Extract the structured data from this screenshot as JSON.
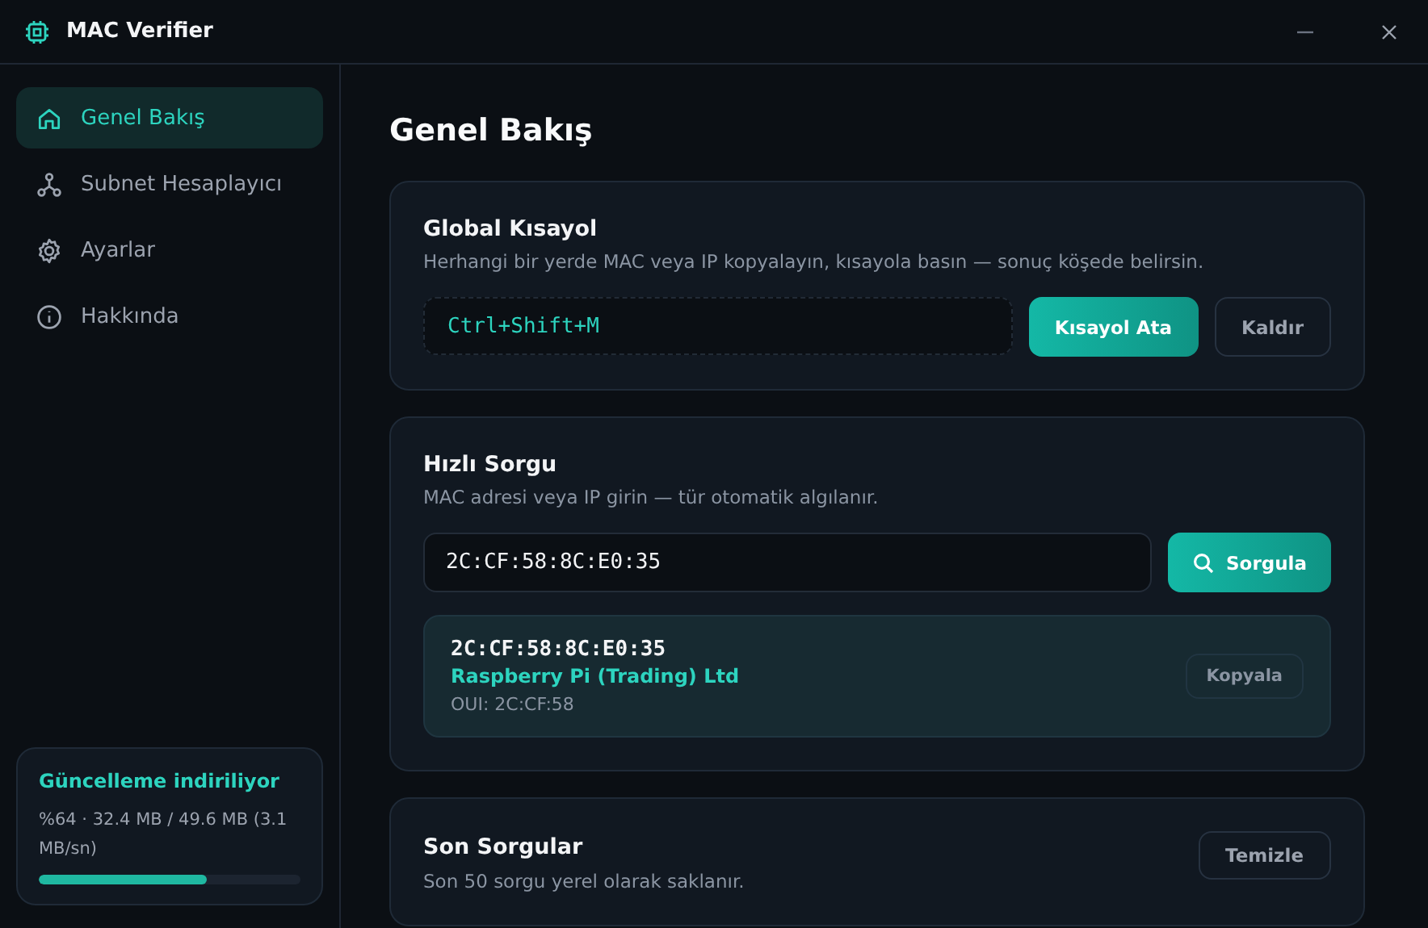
{
  "window": {
    "title": "MAC Verifier"
  },
  "sidebar": {
    "items": [
      {
        "label": "Genel Bakış",
        "selected": true
      },
      {
        "label": "Subnet Hesaplayıcı",
        "selected": false
      },
      {
        "label": "Ayarlar",
        "selected": false
      },
      {
        "label": "Hakkında",
        "selected": false
      }
    ],
    "update": {
      "title": "Güncelleme indiriliyor",
      "detail": "%64 · 32.4 MB / 49.6 MB (3.1 MB/sn)",
      "level": 0.64
    }
  },
  "page": {
    "title": "Genel Bakış"
  },
  "shortcut_card": {
    "title": "Global Kısayol",
    "description": "Herhangi bir yerde MAC veya IP kopyalayın, kısayola basın — sonuç köşede belirsin.",
    "shortcut": "Ctrl+Shift+M",
    "buttons": [
      "Kısayol Ata",
      "Kaldır"
    ]
  },
  "query_card": {
    "title": "Hızlı Sorgu",
    "description": "MAC adresi veya IP girin — tür otomatik algılanır.",
    "value": "2C:CF:58:8C:E0:35",
    "button": "Sorgula",
    "result": {
      "address": "2C:CF:58:8C:E0:35",
      "vendor": "Raspberry Pi (Trading) Ltd",
      "oui": "OUI: 2C:CF:58",
      "button": "Kopyala"
    }
  },
  "recent_card": {
    "title": "Son Sorgular",
    "description": "Son 50 sorgu yerel olarak saklanır.",
    "button": "Temizle"
  }
}
